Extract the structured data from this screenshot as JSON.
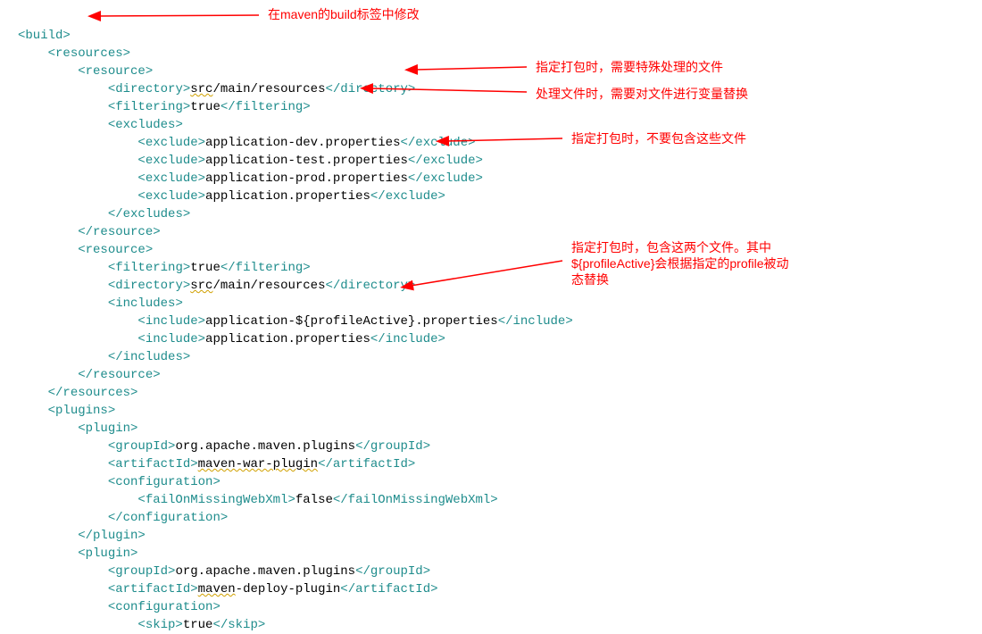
{
  "annotations": {
    "a1": "在maven的build标签中修改",
    "a2": "指定打包时，需要特殊处理的文件",
    "a3": "处理文件时，需要对文件进行变量替换",
    "a4": "指定打包时，不要包含这些文件",
    "a5": "指定打包时，包含这两个文件。其中\n${profileActive}会根据指定的profile被动\n态替换"
  },
  "xml": {
    "build_open": "<build>",
    "resources_open": "<resources>",
    "resource_open": "<resource>",
    "directory_open": "<directory>",
    "directory_val": "src/main/resources",
    "directory_close": "</directory>",
    "filtering_open": "<filtering>",
    "filtering_val": "true",
    "filtering_close": "</filtering>",
    "excludes_open": "<excludes>",
    "exclude_open": "<exclude>",
    "exclude_close": "</exclude>",
    "ex1": "application-dev.properties",
    "ex2": "application-test.properties",
    "ex3": "application-prod.properties",
    "ex4": "application.properties",
    "excludes_close": "</excludes>",
    "resource_close": "</resource>",
    "includes_open": "<includes>",
    "include_open": "<include>",
    "include_close": "</include>",
    "inc1": "application-${profileActive}.properties",
    "inc2": "application.properties",
    "includes_close": "</includes>",
    "resources_close": "</resources>",
    "plugins_open": "<plugins>",
    "plugin_open": "<plugin>",
    "groupId_open": "<groupId>",
    "groupId_val": "org.apache.maven.plugins",
    "groupId_close": "</groupId>",
    "artifactId_open": "<artifactId>",
    "art1": "maven-war-plugin",
    "art2": "maven-deploy-plugin",
    "artifactId_close": "</artifactId>",
    "configuration_open": "<configuration>",
    "failOnMissing_open": "<failOnMissingWebXml>",
    "failOnMissing_val": "false",
    "failOnMissing_close": "</failOnMissingWebXml>",
    "configuration_close": "</configuration>",
    "plugin_close": "</plugin>",
    "skip_open": "<skip>",
    "skip_val": "true",
    "skip_close": "</skip>",
    "src_under": "src"
  }
}
